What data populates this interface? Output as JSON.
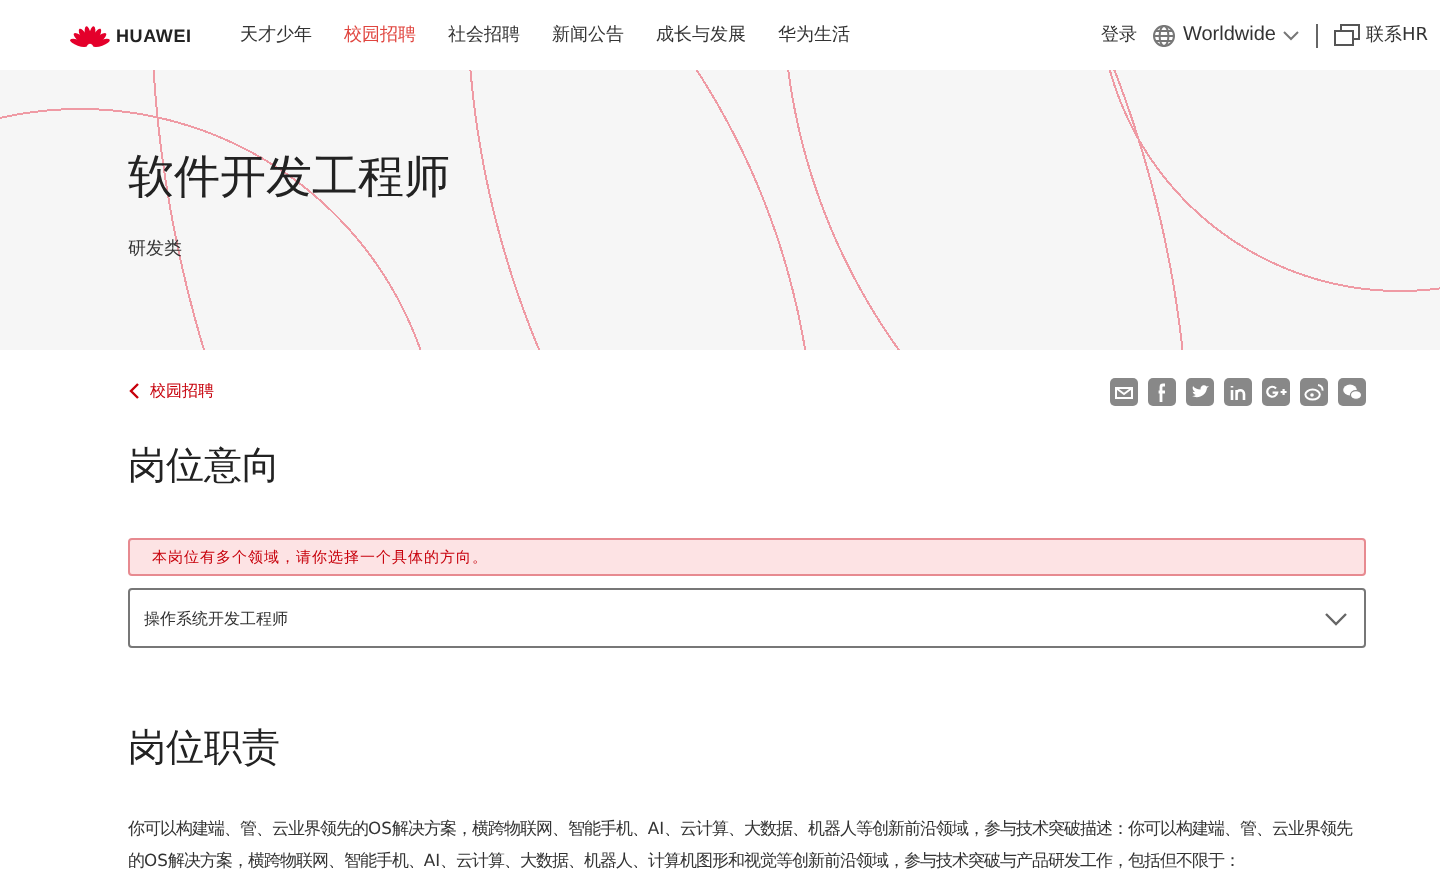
{
  "header": {
    "logo_text": "HUAWEI",
    "nav": [
      {
        "label": "天才少年",
        "selected": false
      },
      {
        "label": "校园招聘",
        "selected": true
      },
      {
        "label": "社会招聘",
        "selected": false
      },
      {
        "label": "新闻公告",
        "selected": false
      },
      {
        "label": "成长与发展",
        "selected": false
      },
      {
        "label": "华为生活",
        "selected": false
      }
    ],
    "login": "登录",
    "region": "Worldwide",
    "contact": "联系HR"
  },
  "hero": {
    "title": "软件开发工程师",
    "category": "研发类"
  },
  "breadcrumb": {
    "back": "校园招聘"
  },
  "intent": {
    "heading": "岗位意向",
    "alert": "本岗位有多个领域，请你选择一个具体的方向。",
    "select_value": "操作系统开发工程师"
  },
  "duties": {
    "heading": "岗位职责",
    "text": "你可以构建端、管、云业界领先的OS解决方案，横跨物联网、智能手机、AI、云计算、大数据、机器人等创新前沿领域，参与技术突破描述：你可以构建端、管、云业界领先的OS解决方案，横跨物联网、智能手机、AI、云计算、大数据、机器人、计算机图形和视觉等创新前沿领域，参与技术突破与产品研发工作，包括但不限于："
  }
}
